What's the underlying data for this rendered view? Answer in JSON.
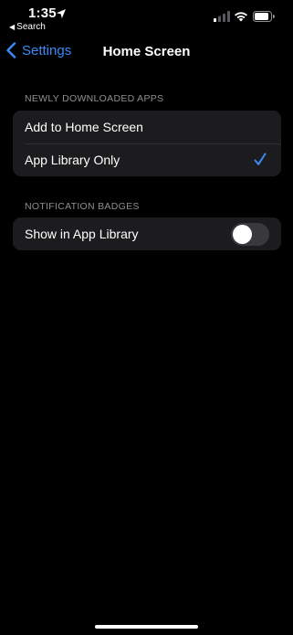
{
  "status_bar": {
    "time": "1:35",
    "back_app_label": "Search",
    "icons": [
      "location-arrow-icon",
      "cellular-signal-icon",
      "wifi-icon",
      "battery-icon"
    ]
  },
  "nav": {
    "back_label": "Settings",
    "title": "Home Screen"
  },
  "sections": {
    "newly_downloaded": {
      "header": "NEWLY DOWNLOADED APPS",
      "options": [
        {
          "label": "Add to Home Screen",
          "selected": false
        },
        {
          "label": "App Library Only",
          "selected": true
        }
      ]
    },
    "notification_badges": {
      "header": "NOTIFICATION BADGES",
      "toggle_label": "Show in App Library",
      "toggle_on": false
    }
  },
  "colors": {
    "accent": "#3a8bf7",
    "background": "#000000",
    "group_background": "#1c1c1e",
    "secondary_text": "#8e8e93"
  }
}
